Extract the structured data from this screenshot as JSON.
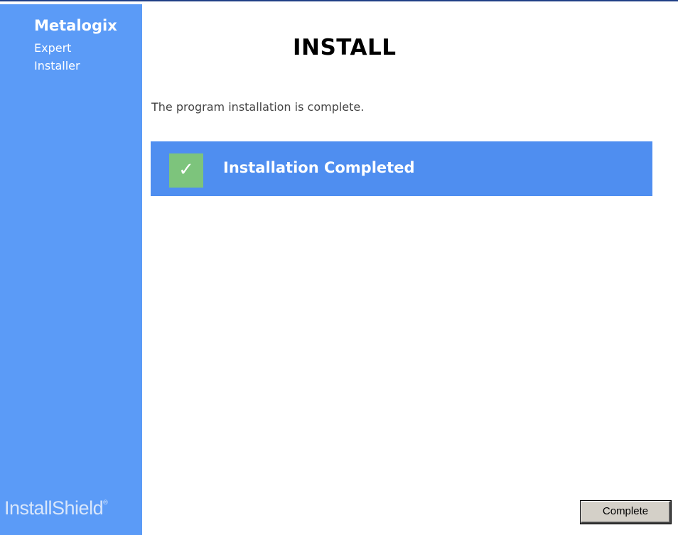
{
  "sidebar": {
    "brand_name": "Metalogix",
    "brand_line1": "Expert",
    "brand_line2": "Installer",
    "footer_logo": "InstallShield",
    "footer_logo_mark": "®",
    "background_color": "#5b9bf7"
  },
  "main": {
    "title": "INSTALL",
    "message": "The program installation is complete.",
    "status": {
      "icon": "check-icon",
      "icon_glyph": "✓",
      "label": "Installation Completed",
      "bar_color": "#4f8ef0",
      "icon_color": "#7dc47c"
    }
  },
  "footer": {
    "complete_label": "Complete"
  }
}
